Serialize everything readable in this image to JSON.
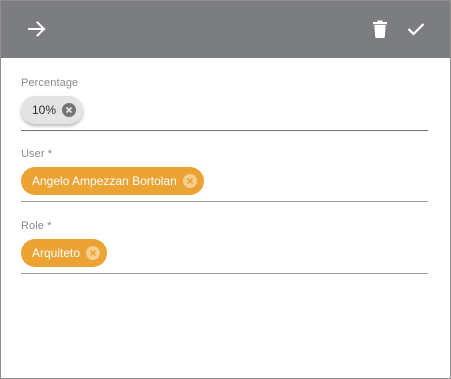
{
  "toolbar": {
    "back_icon": "arrow-right-icon",
    "delete_icon": "trash-icon",
    "save_icon": "check-icon",
    "background": "#7c7d80"
  },
  "form": {
    "percentage": {
      "label": "Percentage",
      "chip_value": "10%"
    },
    "user": {
      "label": "User *",
      "chip_value": "Angelo Ampezzan Bortolan"
    },
    "role": {
      "label": "Role *",
      "chip_value": "Arquiteto"
    }
  },
  "colors": {
    "chip_accent": "#eba333",
    "chip_neutral": "#e4e4e4",
    "label": "#8a8a8a"
  }
}
